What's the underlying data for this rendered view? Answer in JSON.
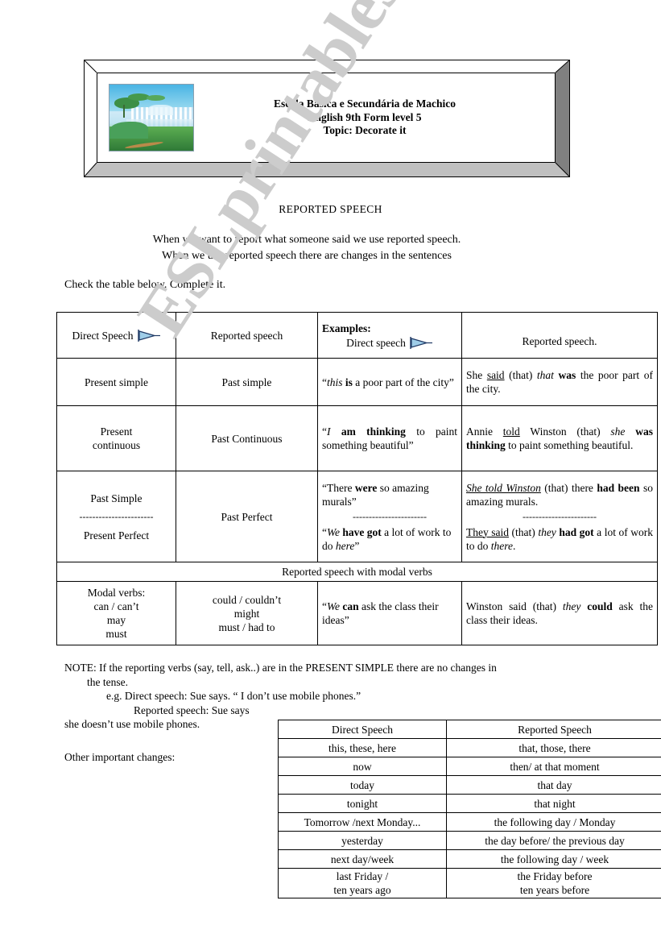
{
  "watermark": {
    "text": "ESLprintables.com"
  },
  "header": {
    "image_name": "waterfall-savanna-landscape-painting",
    "line1": "Escola Básica e Secundária de Machico",
    "line2": "English 9th Form level 5",
    "line3": "Topic: Decorate it"
  },
  "section_title": "REPORTED SPEECH",
  "intro": {
    "line1": "When we want to report what someone said we use reported speech.",
    "line2": "When we use reported speech there are changes in the sentences"
  },
  "check_line": "Check the table below.  Complete it.",
  "main_table": {
    "header": {
      "direct_speech": "Direct Speech",
      "reported_speech": "Reported speech",
      "examples_label": "Examples:",
      "examples_direct": "Direct speech",
      "examples_reported": "Reported speech."
    },
    "rows": [
      {
        "direct": "Present simple",
        "reported": "Past simple",
        "example_direct_html": "&ldquo;<i>this</i> <b>is</b> a poor part of the city&rdquo;",
        "example_reported_html": "She <u>said</u> (that) <i>that</i> <b>was</b> the  poor part of the city."
      },
      {
        "direct": "Present\ncontinuous",
        "reported": "Past Continuous",
        "example_direct_html": "&ldquo;<i>I</i> <b>am thinking</b> to paint something  beautiful&rdquo;",
        "example_reported_html": "Annie <u>told</u> Winston (that) <i>she</i> <b>was thinking</b> to paint something beautiful."
      },
      {
        "direct_top": "Past Simple",
        "direct_bottom": "Present Perfect",
        "reported": "Past Perfect",
        "example_direct_top_html": "&ldquo;There <b>were</b> so amazing murals&rdquo;",
        "example_direct_bottom_html": "&ldquo;<i>We</i> <b>have got</b> a lot of work to do <i>here</i>&rdquo;",
        "example_reported_top_html": "<u><i>She told Winston</i></u> (that) there <b>had been</b> so amazing murals.",
        "example_reported_bottom_html": "<u>They  said</u> (that) <i>they</i> <b>had got</b> a lot of work to do <i>there</i>."
      }
    ],
    "modal_band": "Reported speech with modal verbs",
    "modal_row": {
      "direct": "Modal verbs:\ncan / can’t\nmay\nmust",
      "reported": "could / couldn’t\nmight\nmust / had to",
      "example_direct_html": "&ldquo;<i>We</i> <b>can</b> ask the class their ideas&rdquo;",
      "example_reported_html": " Winston said (that) <i>they</i> <b>could</b> ask the class their ideas."
    },
    "dash_separator": "-----------------------"
  },
  "note": {
    "line1": "NOTE: If the reporting verbs (say, tell, ask..) are in the PRESENT SIMPLE there are no changes in",
    "line2": "the tense.",
    "line3": "e.g. Direct speech:     Sue says. “ I don’t use mobile phones.”",
    "line4": "Reported  speech:  Sue  says",
    "line5": "she doesn’t use mobile phones."
  },
  "other_changes_label": "Other important changes:",
  "changes_table": {
    "headers": [
      "Direct Speech",
      "Reported Speech"
    ],
    "rows": [
      [
        "this, these, here",
        "that, those, there"
      ],
      [
        "now",
        "then/ at that moment"
      ],
      [
        "today",
        "that day"
      ],
      [
        "tonight",
        "that night"
      ],
      [
        "Tomorrow /next Monday...",
        "the following day / Monday"
      ],
      [
        "yesterday",
        "the day before/ the previous day"
      ],
      [
        "next day/week",
        "the following day / week"
      ],
      [
        "last Friday /\nten years ago",
        "the Friday before\nten years before"
      ]
    ]
  },
  "colors": {
    "arrow_fill": "#9fcde8",
    "arrow_stroke": "#1f3864",
    "watermark": "#cccccc",
    "frame_dark": "#808080",
    "frame_light": "#c0c0c0"
  }
}
